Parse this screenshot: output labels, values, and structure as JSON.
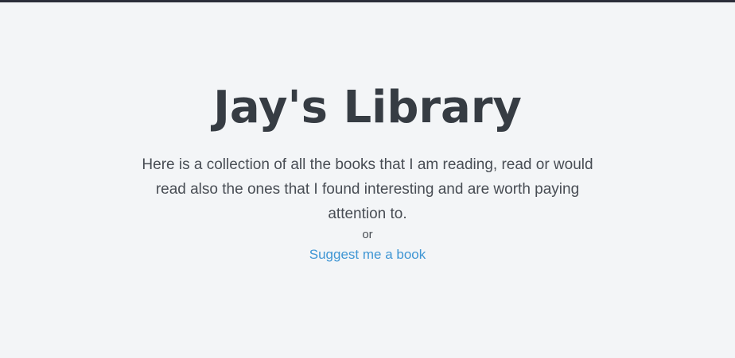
{
  "header": {
    "title": "Jay's Library"
  },
  "main": {
    "description": "Here is a collection of all the books that I am reading, read or would read also the ones that I found interesting and are worth paying attention to.",
    "separator": "or",
    "suggest_link_label": "Suggest me a book"
  },
  "colors": {
    "background": "#f3f5f7",
    "top_bar": "#2b2d3a",
    "title": "#363c43",
    "body_text": "#484d54",
    "link": "#3f96d4"
  }
}
